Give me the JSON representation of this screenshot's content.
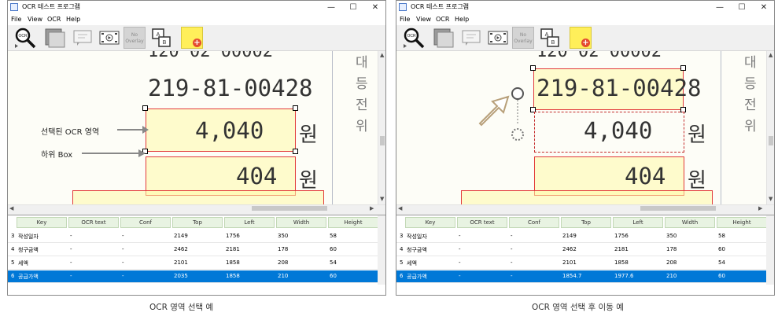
{
  "window": {
    "title": "OCR 테스트 프로그램",
    "minimize": "—",
    "maximize": "☐",
    "close": "✕"
  },
  "menu": [
    "File",
    "View",
    "OCR",
    "Help"
  ],
  "toolbar": {
    "no_overlay_label": "No Overlay",
    "icons": [
      "ocr-search-icon",
      "region-select-icon",
      "text-view-icon",
      "video-icon",
      "no-overlay-icon",
      "compare-icon",
      "add-note-icon"
    ]
  },
  "document": {
    "top_partial": "120 02 00002",
    "business_number": "219-81-00428",
    "amount": "4,040",
    "currency_unit": "원",
    "tax": "404",
    "side_chars": [
      "대",
      "등",
      "전",
      "위"
    ]
  },
  "annotations": {
    "selected_area_label": "선택된 OCR 영역",
    "sub_box_label": "하위 Box"
  },
  "grid": {
    "columns": [
      "Key",
      "OCR text",
      "Conf",
      "Top",
      "Left",
      "Width",
      "Height"
    ],
    "left_rows": [
      {
        "num": "3",
        "key": "작성일자",
        "ocr": "-",
        "conf": "-",
        "top": "2149",
        "left": "1756",
        "width": "350",
        "height": "58"
      },
      {
        "num": "4",
        "key": "청구금액",
        "ocr": "-",
        "conf": "-",
        "top": "2462",
        "left": "2181",
        "width": "178",
        "height": "60"
      },
      {
        "num": "5",
        "key": "세액",
        "ocr": "-",
        "conf": "-",
        "top": "2101",
        "left": "1858",
        "width": "208",
        "height": "54"
      },
      {
        "num": "6",
        "key": "공급가액",
        "ocr": "-",
        "conf": "-",
        "top": "2035",
        "left": "1858",
        "width": "210",
        "height": "60"
      }
    ],
    "right_rows": [
      {
        "num": "3",
        "key": "작성일자",
        "ocr": "-",
        "conf": "-",
        "top": "2149",
        "left": "1756",
        "width": "350",
        "height": "58"
      },
      {
        "num": "4",
        "key": "청구금액",
        "ocr": "-",
        "conf": "-",
        "top": "2462",
        "left": "2181",
        "width": "178",
        "height": "60"
      },
      {
        "num": "5",
        "key": "세액",
        "ocr": "-",
        "conf": "-",
        "top": "2101",
        "left": "1858",
        "width": "208",
        "height": "54"
      },
      {
        "num": "6",
        "key": "공급가액",
        "ocr": "-",
        "conf": "-",
        "top": "1854.7",
        "left": "1977.6",
        "width": "210",
        "height": "60"
      }
    ],
    "selected_row": 3
  },
  "captions": {
    "left": "OCR 영역 선택 예",
    "right": "OCR 영역 선택 후 이동 예"
  },
  "colors": {
    "selection_box": "#e23a3a",
    "highlight_fill": "#fff9aa",
    "selected_row": "#0078d7",
    "grid_header": "#e8f3e2"
  }
}
